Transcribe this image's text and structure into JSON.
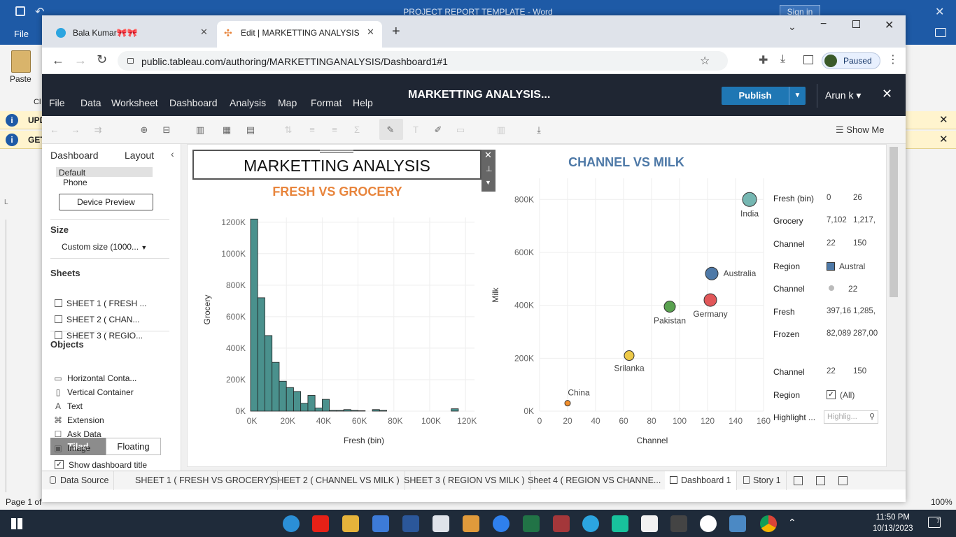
{
  "word": {
    "title": "PROJECT REPORT TEMPLATE  -  Word",
    "sign_in": "Sign in",
    "file_tab": "File",
    "paste_label": "Paste",
    "clipboard_label": "Cl",
    "info1": "UPD",
    "info2": "GET",
    "status_page": "Page 1 of",
    "zoom": "100%",
    "colors": {
      "blue": "#1e5aa6"
    }
  },
  "browser": {
    "tab1_title": "Bala Kumar🎀🎀",
    "tab2_title": "Edit | MARKETTING ANALYSIS",
    "url": "public.tableau.com/authoring/MARKETTINGANALYSIS/Dashboard1#1",
    "profile_status": "Paused"
  },
  "tableau": {
    "menus": [
      "File",
      "Data",
      "Worksheet",
      "Dashboard",
      "Analysis",
      "Map",
      "Format",
      "Help"
    ],
    "workbook_title": "MARKETTING ANALYSIS...",
    "publish_label": "Publish",
    "user_label": "Arun k",
    "show_me": "Show Me",
    "left_tabs": {
      "dashboard": "Dashboard",
      "layout": "Layout"
    },
    "device_options": [
      "Default",
      "Phone"
    ],
    "device_preview": "Device Preview",
    "size_heading": "Size",
    "size_value": "Custom size (1000...",
    "sheets_heading": "Sheets",
    "sheets": [
      "SHEET 1 ( FRESH ...",
      "SHEET 2 ( CHAN...",
      "SHEET 3 ( REGIO..."
    ],
    "objects_heading": "Objects",
    "objects": [
      {
        "icon": "horizontal-container-icon",
        "glyph": "▭",
        "label": "Horizontal Conta..."
      },
      {
        "icon": "vertical-container-icon",
        "glyph": "▯",
        "label": "Vertical Container"
      },
      {
        "icon": "text-icon",
        "glyph": "A",
        "label": "Text"
      },
      {
        "icon": "extension-icon",
        "glyph": "⌘",
        "label": "Extension"
      },
      {
        "icon": "ask-data-icon",
        "glyph": "☐",
        "label": "Ask Data"
      },
      {
        "icon": "image-icon",
        "glyph": "▣",
        "label": "Image"
      }
    ],
    "tiled_label": "Tiled",
    "floating_label": "Floating",
    "show_title_label": "Show dashboard title",
    "dashboard_title": "MARKETTING ANALYSIS",
    "sheet_tabs": [
      {
        "label": "Data Source",
        "icon": "database-icon"
      },
      {
        "label": "SHEET 1 ( FRESH VS GROCERY)"
      },
      {
        "label": "SHEET 2 ( CHANNEL VS MILK )"
      },
      {
        "label": "SHEET 3 ( REGION VS MILK )"
      },
      {
        "label": "Sheet 4 ( REGION VS CHANNE..."
      },
      {
        "label": "Dashboard 1",
        "active": true
      },
      {
        "label": "Story 1"
      }
    ],
    "colors": {
      "header": "#1f2633",
      "publish": "#1f77b4",
      "hist": "#4a918d",
      "title_orange": "#e8853d",
      "title_blue": "#4e79a7"
    }
  },
  "legend": {
    "rows": [
      {
        "label": "Fresh (bin)",
        "v1": "0",
        "v2": "26"
      },
      {
        "label": "Grocery",
        "v1": "7,102",
        "v2": "1,217,"
      },
      {
        "label": "Channel",
        "v1": "22",
        "v2": "150"
      },
      {
        "label": "Region",
        "v1": "Austral",
        "v2": ""
      },
      {
        "label": "Channel",
        "v1": "22",
        "v2": ""
      },
      {
        "label": "Fresh",
        "v1": "397,16",
        "v2": "1,285,"
      },
      {
        "label": "Frozen",
        "v1": "82,089",
        "v2": "287,00"
      },
      {
        "label": "Channel",
        "v1": "22",
        "v2": "150"
      },
      {
        "label": "Region",
        "v1": "(All)",
        "v2": ""
      },
      {
        "label": "Highlight ...",
        "v1": "Highlig...",
        "v2": ""
      }
    ]
  },
  "chart_data": [
    {
      "type": "bar",
      "title": "FRESH VS GROCERY",
      "xlabel": "Fresh (bin)",
      "ylabel": "Grocery",
      "x_ticks": [
        "0K",
        "20K",
        "40K",
        "60K",
        "80K",
        "100K",
        "120K"
      ],
      "y_ticks": [
        "0K",
        "200K",
        "400K",
        "600K",
        "800K",
        "1000K",
        "1200K"
      ],
      "xlim": [
        0,
        125000
      ],
      "ylim": [
        0,
        1230000
      ],
      "bin_width": 4000,
      "bins_start": [
        0,
        4000,
        8000,
        12000,
        16000,
        20000,
        24000,
        28000,
        32000,
        36000,
        40000,
        44000,
        48000,
        52000,
        56000,
        60000,
        68000,
        72000,
        112000
      ],
      "values": [
        1220000,
        720000,
        480000,
        310000,
        190000,
        150000,
        125000,
        50000,
        100000,
        20000,
        75000,
        5000,
        5000,
        10000,
        5000,
        3000,
        10000,
        5000,
        15000
      ]
    },
    {
      "type": "scatter",
      "title": "CHANNEL VS MILK",
      "xlabel": "Channel",
      "ylabel": "Milk",
      "x_ticks": [
        "0",
        "20",
        "40",
        "60",
        "80",
        "100",
        "120",
        "140",
        "160"
      ],
      "y_ticks": [
        "0K",
        "200K",
        "400K",
        "600K",
        "800K"
      ],
      "xlim": [
        0,
        160
      ],
      "ylim": [
        0,
        880000
      ],
      "points": [
        {
          "label": "India",
          "x": 150,
          "y": 800000,
          "color": "#76b7b2",
          "size": 10
        },
        {
          "label": "Australia",
          "x": 123,
          "y": 520000,
          "color": "#4e79a7",
          "size": 9
        },
        {
          "label": "Germany",
          "x": 122,
          "y": 420000,
          "color": "#e15759",
          "size": 9
        },
        {
          "label": "Pakistan",
          "x": 93,
          "y": 395000,
          "color": "#59a14f",
          "size": 8
        },
        {
          "label": "Srilanka",
          "x": 64,
          "y": 210000,
          "color": "#edc948",
          "size": 7
        },
        {
          "label": "China",
          "x": 20,
          "y": 30000,
          "color": "#f28e2b",
          "size": 4
        }
      ]
    }
  ]
}
